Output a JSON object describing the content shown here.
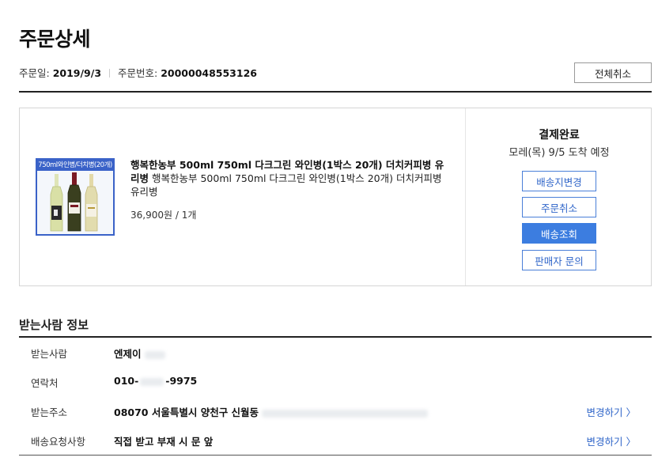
{
  "page": {
    "title": "주문상세"
  },
  "order": {
    "date_label": "주문일:",
    "date": "2019/9/3",
    "number_label": "주문번호:",
    "number": "20000048553126",
    "cancel_all_label": "전체취소"
  },
  "product": {
    "thumb_banner": "750ml와인병/더치병(20개)",
    "name_bold": "행복한농부 500ml 750ml 다크그린 와인병(1박스 20개) 더치커피병 유리병",
    "name_desc": "행복한농부 500ml 750ml 다크그린 와인병(1박스 20개) 더치커피병 유리병",
    "price_qty": "36,900원 / 1개"
  },
  "status": {
    "title": "결제완료",
    "delivery_estimate": "모레(목) 9/5 도착 예정",
    "buttons": {
      "change_address": "배송지변경",
      "cancel_order": "주문취소",
      "track_delivery": "배송조회",
      "seller_inquiry": "판매자 문의"
    }
  },
  "recipient": {
    "section_title": "받는사람 정보",
    "rows": [
      {
        "label": "받는사람",
        "value": "엔제이"
      },
      {
        "label": "연락처",
        "value_prefix": "010-",
        "value_suffix": "-9975"
      },
      {
        "label": "받는주소",
        "value": "08070 서울특별시 양천구 신월동",
        "link": "변경하기 〉"
      },
      {
        "label": "배송요청사항",
        "value": "직접 받고 부재 시 문 앞",
        "link": "변경하기 〉"
      }
    ]
  },
  "colors": {
    "accent": "#3c7de0",
    "link": "#2f65c9",
    "thumb_border": "#3a62c8"
  }
}
